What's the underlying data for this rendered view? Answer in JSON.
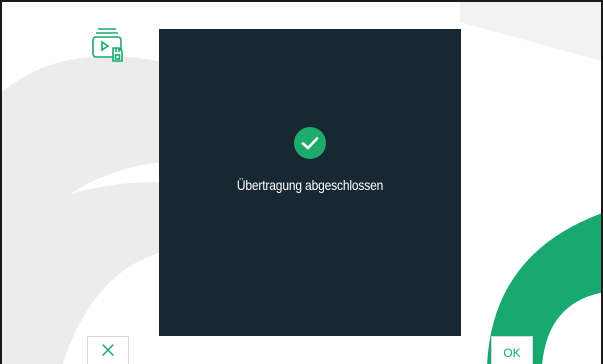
{
  "dialog": {
    "status_icon": "check-circle-icon",
    "message": "Übertragung abgeschlossen"
  },
  "toolbar": {
    "media_icon": "media-sd-card-icon",
    "cancel_icon": "close-icon",
    "ok_label": "OK"
  },
  "colors": {
    "accent": "#17a96e",
    "dialog_background": "#172832",
    "background_shapes": "#ececec"
  }
}
